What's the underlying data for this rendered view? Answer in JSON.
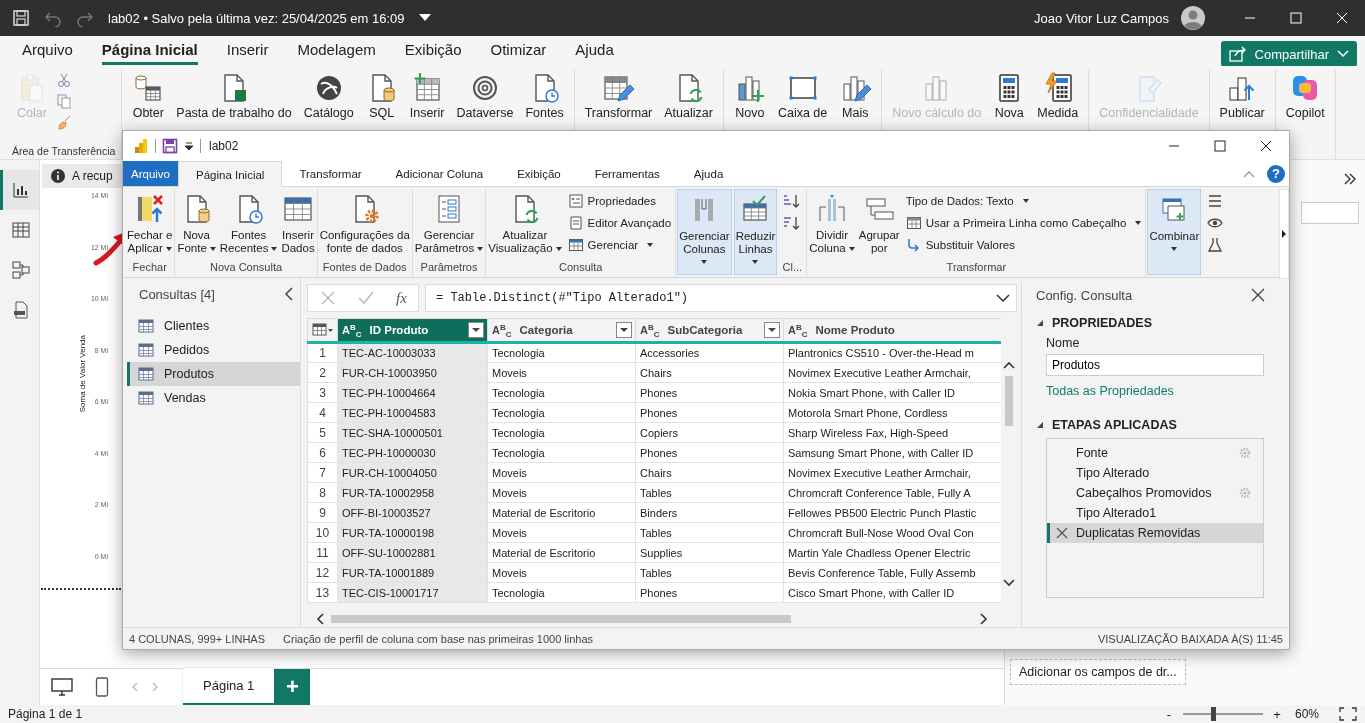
{
  "window": {
    "title": "lab02 • Salvo pela última vez: 25/04/2025 em 16:09",
    "user": "Joao Vitor Luz Campos"
  },
  "menu_tabs": [
    {
      "label": "Arquivo",
      "selected": false
    },
    {
      "label": "Página Inicial",
      "selected": true
    },
    {
      "label": "Inserir",
      "selected": false
    },
    {
      "label": "Modelagem",
      "selected": false
    },
    {
      "label": "Exibição",
      "selected": false
    },
    {
      "label": "Otimizar",
      "selected": false
    },
    {
      "label": "Ajuda",
      "selected": false
    }
  ],
  "share_button": "Compartilhar",
  "ribbon": {
    "groups": [
      {
        "label": "Área de Transferência",
        "buttons": [
          {
            "label": "Colar",
            "disabled": true
          }
        ]
      },
      {
        "buttons": [
          {
            "label": "Obter",
            "disabled": false
          },
          {
            "label": "Pasta de trabalho do",
            "disabled": false
          },
          {
            "label": "Catálogo",
            "disabled": false
          },
          {
            "label": "SQL",
            "disabled": false
          },
          {
            "label": "Inserir",
            "disabled": false
          },
          {
            "label": "Dataverse",
            "disabled": false
          },
          {
            "label": "Fontes",
            "disabled": false
          }
        ]
      },
      {
        "buttons": [
          {
            "label": "Transformar",
            "disabled": false
          },
          {
            "label": "Atualizar",
            "disabled": false
          }
        ]
      },
      {
        "buttons": [
          {
            "label": "Novo",
            "disabled": false
          },
          {
            "label": "Caixa de",
            "disabled": false
          },
          {
            "label": "Mais",
            "disabled": false
          }
        ]
      },
      {
        "buttons": [
          {
            "label": "Novo cálculo do",
            "disabled": true
          },
          {
            "label": "Nova",
            "disabled": false
          },
          {
            "label": "Medida",
            "disabled": false
          }
        ]
      },
      {
        "buttons": [
          {
            "label": "Confidencialidade",
            "disabled": true
          }
        ]
      },
      {
        "buttons": [
          {
            "label": "Publicar",
            "disabled": false
          }
        ]
      },
      {
        "buttons": [
          {
            "label": "Copilot",
            "disabled": false
          }
        ]
      }
    ]
  },
  "left_nav": [
    {
      "selected": true
    },
    {
      "selected": false
    },
    {
      "selected": false
    },
    {
      "selected": false
    }
  ],
  "canvas": {
    "info_bar": "A recup",
    "axis_title": "Soma de Valor Venda",
    "axis_ticks": [
      "14 Mi",
      "12 Mi",
      "10 Mi",
      "8 Mi",
      "6 Mi",
      "4 Mi",
      "2 Mi",
      "0 Mi"
    ]
  },
  "fields_pane": {
    "drop_hint": "Adicionar os campos de dr..."
  },
  "page_tabs": [
    {
      "label": "Página 1",
      "selected": true
    }
  ],
  "add_page": "+",
  "status_bar": {
    "page": "Página 1 de 1",
    "zoom_out": "-",
    "zoom_in": "+",
    "zoom": {
      "level": 0.38
    },
    "zoom_reading": "60%"
  },
  "editor": {
    "title": "lab02",
    "help": "?",
    "tabs": [
      {
        "label": "Arquivo",
        "kind": "file",
        "selected": false
      },
      {
        "label": "Página Inicial",
        "kind": "tab",
        "selected": true
      },
      {
        "label": "Transformar",
        "kind": "tab",
        "selected": false
      },
      {
        "label": "Adicionar Coluna",
        "kind": "tab",
        "selected": false
      },
      {
        "label": "Exibição",
        "kind": "tab",
        "selected": false
      },
      {
        "label": "Ferramentas",
        "kind": "tab",
        "selected": false
      },
      {
        "label": "Ajuda",
        "kind": "tab",
        "selected": false
      }
    ],
    "ribbon_groups": [
      {
        "kind": "standard",
        "label": "Fechar",
        "buttons": [
          {
            "label": "Fechar e\nAplicar",
            "dropdown": true
          }
        ]
      },
      {
        "kind": "standard",
        "label": "Nova Consulta",
        "buttons": [
          {
            "label": "Nova\nFonte",
            "dropdown": true
          },
          {
            "label": "Fontes\nRecentes",
            "dropdown": true
          },
          {
            "label": "Inserir\nDados",
            "dropdown": false
          }
        ]
      },
      {
        "kind": "standard",
        "label": "Fontes de Dados",
        "buttons": [
          {
            "label": "Configurações da\nfonte de dados",
            "dropdown": false
          }
        ]
      },
      {
        "kind": "standard",
        "label": "Parâmetros",
        "buttons": [
          {
            "label": "Gerenciar\nParâmetros",
            "dropdown": true
          }
        ]
      },
      {
        "kind": "standard",
        "label": "Consulta",
        "buttons": [
          {
            "label": "Atualizar\nVisualização",
            "dropdown": true
          }
        ],
        "small_buttons": [
          {
            "label": "Propriedades",
            "dropdown": false
          },
          {
            "label": "Editor Avançado",
            "dropdown": false
          },
          {
            "label": "Gerenciar",
            "dropdown": true
          }
        ]
      },
      {
        "kind": "collapsed",
        "buttons": [
          {
            "label": "Gerenciar\nColunas",
            "dropdown": true
          }
        ]
      },
      {
        "kind": "collapsed",
        "buttons": [
          {
            "label": "Reduzir\nLinhas",
            "dropdown": true
          }
        ]
      },
      {
        "kind": "sort",
        "label": "Cl..."
      },
      {
        "kind": "standard",
        "label": "Transformar",
        "buttons": [
          {
            "label": "Dividir\nColuna",
            "dropdown": true
          },
          {
            "label": "Agrupar\npor",
            "dropdown": false
          }
        ],
        "small_buttons": [
          {
            "label": "Tipo de Dados: Texto",
            "dropdown": true
          },
          {
            "label": "Usar a Primeira Linha como Cabeçalho",
            "dropdown": true
          },
          {
            "label": "Substituir Valores",
            "dropdown": false
          }
        ]
      },
      {
        "kind": "collapsed",
        "buttons": [
          {
            "label": "Combinar",
            "dropdown": true
          }
        ]
      },
      {
        "kind": "cutoff"
      }
    ],
    "queries": {
      "title": "Consultas [4]",
      "items": [
        {
          "name": "Clientes",
          "selected": false
        },
        {
          "name": "Pedidos",
          "selected": false
        },
        {
          "name": "Produtos",
          "selected": true
        },
        {
          "name": "Vendas",
          "selected": false
        }
      ]
    },
    "formula_bar": {
      "function_label": "fx",
      "formula": "= Table.Distinct(#\"Tipo Alterado1\")"
    },
    "table": {
      "columns": [
        {
          "name": "ID Produto",
          "type": "A$^{B}$$_{C}$",
          "selected": true,
          "filter": true
        },
        {
          "name": "Categoria",
          "type": "A$^{B}$$_{C}$",
          "selected": false,
          "filter": true
        },
        {
          "name": "SubCategoria",
          "type": "A$^{B}$$_{C}$",
          "selected": false,
          "filter": true
        },
        {
          "name": "Nome Produto",
          "type": "A$^{B}$$_{C}$",
          "selected": false,
          "filter": false
        }
      ],
      "rows": [
        {
          "number": "1",
          "cells": [
            "TEC-AC-10003033",
            "Tecnologia",
            "Accessories",
            "Plantronics CS510 - Over-the-Head m"
          ]
        },
        {
          "number": "2",
          "cells": [
            "FUR-CH-10003950",
            "Moveis",
            "Chairs",
            "Novimex Executive Leather Armchair,"
          ]
        },
        {
          "number": "3",
          "cells": [
            "TEC-PH-10004664",
            "Tecnologia",
            "Phones",
            "Nokia Smart Phone, with Caller ID"
          ]
        },
        {
          "number": "4",
          "cells": [
            "TEC-PH-10004583",
            "Tecnologia",
            "Phones",
            "Motorola Smart Phone, Cordless"
          ]
        },
        {
          "number": "5",
          "cells": [
            "TEC-SHA-10000501",
            "Tecnologia",
            "Copiers",
            "Sharp Wireless Fax, High-Speed"
          ]
        },
        {
          "number": "6",
          "cells": [
            "TEC-PH-10000030",
            "Tecnologia",
            "Phones",
            "Samsung Smart Phone, with Caller ID"
          ]
        },
        {
          "number": "7",
          "cells": [
            "FUR-CH-10004050",
            "Moveis",
            "Chairs",
            "Novimex Executive Leather Armchair,"
          ]
        },
        {
          "number": "8",
          "cells": [
            "FUR-TA-10002958",
            "Moveis",
            "Tables",
            "Chromcraft Conference Table, Fully A"
          ]
        },
        {
          "number": "9",
          "cells": [
            "OFF-BI-10003527",
            "Material de Escritorio",
            "Binders",
            "Fellowes PB500 Electric Punch Plastic"
          ]
        },
        {
          "number": "10",
          "cells": [
            "FUR-TA-10000198",
            "Moveis",
            "Tables",
            "Chromcraft Bull-Nose Wood Oval Con"
          ]
        },
        {
          "number": "11",
          "cells": [
            "OFF-SU-10002881",
            "Material de Escritorio",
            "Supplies",
            "Martin Yale Chadless Opener Electric"
          ]
        },
        {
          "number": "12",
          "cells": [
            "FUR-TA-10001889",
            "Moveis",
            "Tables",
            "Bevis Conference Table, Fully Assemb"
          ]
        },
        {
          "number": "13",
          "cells": [
            "TEC-CIS-10001717",
            "Tecnologia",
            "Phones",
            "Cisco Smart Phone, with Caller ID"
          ]
        }
      ]
    },
    "settings": {
      "title": "Config. Consulta",
      "properties_heading": "PROPRIEDADES",
      "name_label": "Nome",
      "name_value": "Produtos",
      "all_properties_link": "Todas as Propriedades",
      "steps_heading": "ETAPAS APLICADAS",
      "steps": [
        {
          "name": "Fonte",
          "has_settings": true,
          "selected": false
        },
        {
          "name": "Tipo Alterado",
          "has_settings": false,
          "selected": false
        },
        {
          "name": "Cabeçalhos Promovidos",
          "has_settings": true,
          "selected": false
        },
        {
          "name": "Tipo Alterado1",
          "has_settings": false,
          "selected": false
        },
        {
          "name": "Duplicatas Removidas",
          "has_settings": false,
          "selected": true
        }
      ]
    },
    "status": {
      "counts": "4 COLUNAS, 999+ LINHAS",
      "profiling": "Criação de perfil de coluna com base nas primeiras 1000 linhas",
      "preview_time": "VISUALIZAÇÃO BAIXADA À(S) 11:45"
    }
  }
}
